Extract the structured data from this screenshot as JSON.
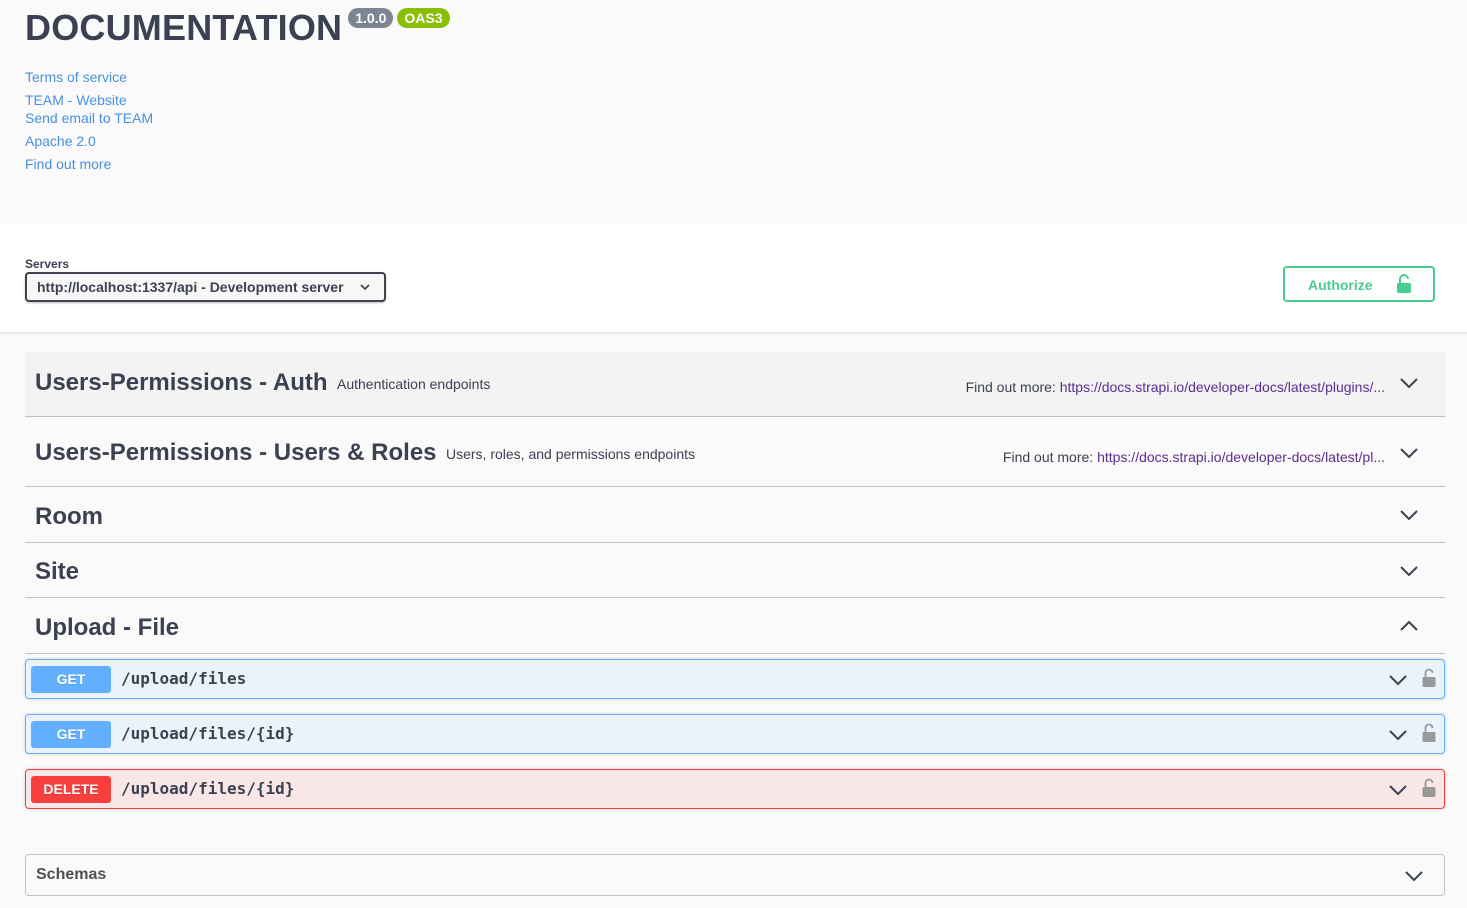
{
  "info": {
    "title": "DOCUMENTATION",
    "version_badge": "1.0.0",
    "oas_badge": "OAS3",
    "links": {
      "terms": "Terms of service",
      "website": "TEAM - Website",
      "email": "Send email to TEAM",
      "license": "Apache 2.0",
      "find_out_more": "Find out more"
    }
  },
  "servers": {
    "label": "Servers",
    "selected": "http://localhost:1337/api - Development server"
  },
  "authorize": {
    "label": "Authorize",
    "icon": "unlock-icon",
    "color": "#49cc90"
  },
  "tags": [
    {
      "name": "Users-Permissions - Auth",
      "description": "Authentication endpoints",
      "find_more_label": "Find out more:",
      "find_more_link": "https://docs.strapi.io/developer-docs/latest/plugins/...",
      "expanded": false
    },
    {
      "name": "Users-Permissions - Users & Roles",
      "description": "Users, roles, and permissions endpoints",
      "find_more_label": "Find out more:",
      "find_more_link": "https://docs.strapi.io/developer-docs/latest/pl...",
      "expanded": false
    },
    {
      "name": "Room",
      "expanded": false
    },
    {
      "name": "Site",
      "expanded": false
    },
    {
      "name": "Upload - File",
      "expanded": true
    }
  ],
  "operations": [
    {
      "method": "GET",
      "path": "/upload/files",
      "color": "#61affe"
    },
    {
      "method": "GET",
      "path": "/upload/files/{id}",
      "color": "#61affe"
    },
    {
      "method": "DELETE",
      "path": "/upload/files/{id}",
      "color": "#f93e3e"
    }
  ],
  "schemas": {
    "title": "Schemas"
  }
}
